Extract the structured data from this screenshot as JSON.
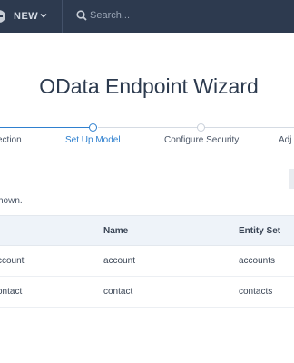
{
  "topbar": {
    "new_label": "NEW",
    "search_placeholder": "Search..."
  },
  "page_title": "OData Endpoint Wizard",
  "wizard": {
    "steps": [
      {
        "label": "ection",
        "state": "completed"
      },
      {
        "label": "Set Up Model",
        "state": "active"
      },
      {
        "label": "Configure Security",
        "state": "upcoming"
      },
      {
        "label": "Adj",
        "state": "upcoming"
      }
    ]
  },
  "info_text": "hown.",
  "table": {
    "columns": [
      "Name",
      "Entity Set"
    ],
    "rows": [
      {
        "first": "ccount",
        "name": "account",
        "entity_set": "accounts"
      },
      {
        "first": "ontact",
        "name": "contact",
        "entity_set": "contacts"
      }
    ]
  },
  "colors": {
    "topbar": "#2d3a4f",
    "accent": "#2f80cf",
    "header_bg": "#eef3f9"
  }
}
